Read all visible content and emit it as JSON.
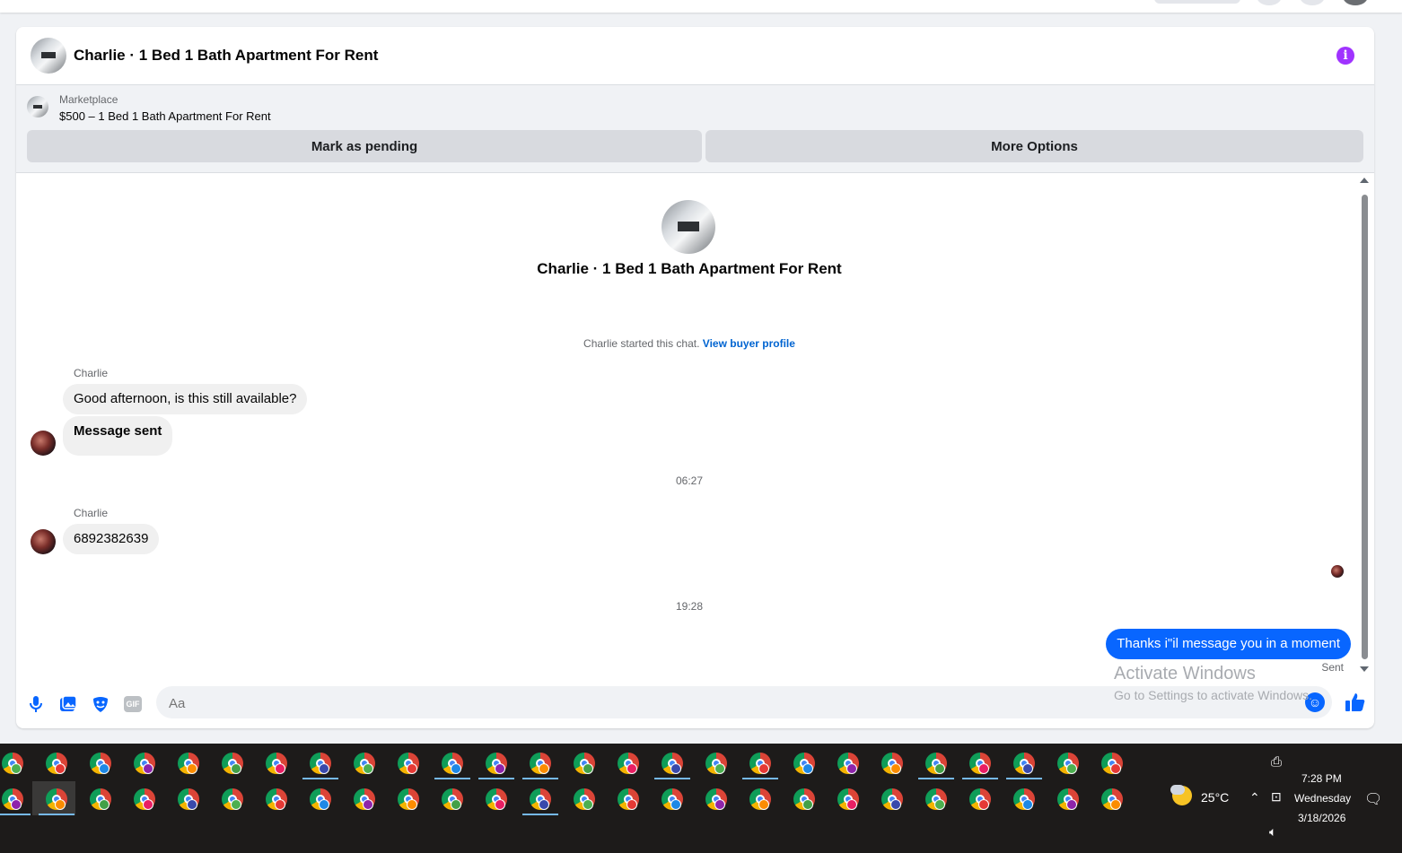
{
  "header": {
    "title": "Charlie · 1 Bed 1 Bath Apartment For Rent"
  },
  "listing": {
    "category": "Marketplace",
    "title": "$500 – 1 Bed 1 Bath Apartment For Rent",
    "mark_pending_label": "Mark as pending",
    "more_options_label": "More Options"
  },
  "chat": {
    "center_title": "Charlie · 1 Bed 1 Bath Apartment For Rent",
    "started_text": "Charlie started this chat.",
    "view_profile_link": "View buyer profile",
    "messages": [
      {
        "sender": "Charlie",
        "text": "Good afternoon, is this still available?"
      },
      {
        "text": "Message sent"
      },
      {
        "time": "06:27"
      },
      {
        "sender": "Charlie",
        "text": "6892382639"
      },
      {
        "time": "19:28"
      },
      {
        "text": "Thanks i\"il message you in a moment",
        "status": "Sent"
      }
    ]
  },
  "composer": {
    "placeholder": "Aa",
    "gif_label": "GIF"
  },
  "watermark": {
    "line1": "Activate Windows",
    "line2": "Go to Settings to activate Windows."
  },
  "taskbar": {
    "weather_temp": "25°C",
    "time": "7:28 PM",
    "day": "Wednesday",
    "date": "3/18/2026"
  },
  "colors": {
    "accent": "#0866ff",
    "info": "#a033ff",
    "link": "#0064d1"
  }
}
